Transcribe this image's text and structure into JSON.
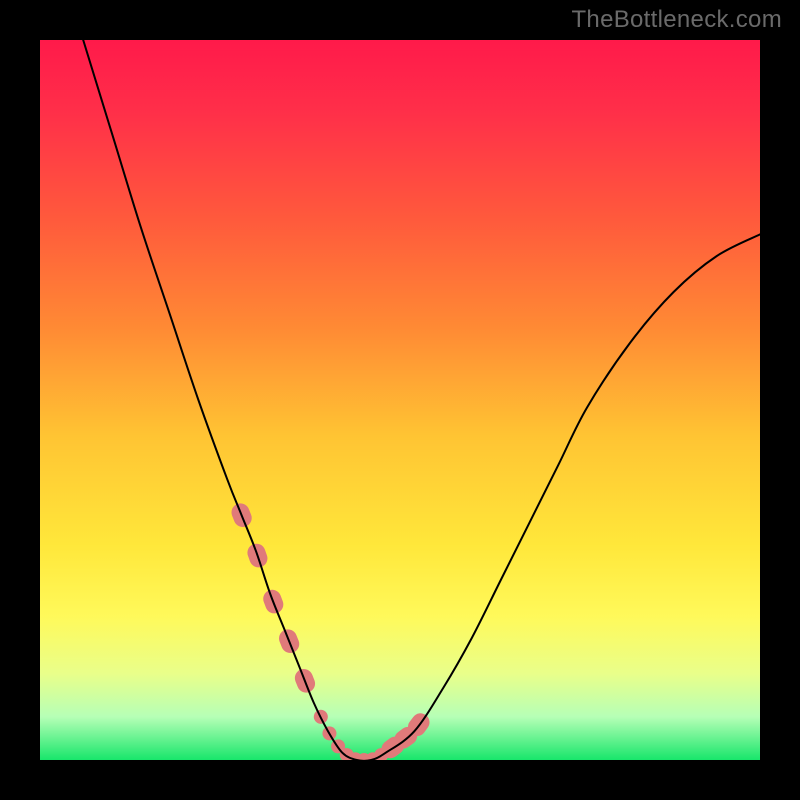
{
  "watermark": "TheBottleneck.com",
  "gradient_stops": [
    {
      "offset": 0.0,
      "color": "#ff1a4a"
    },
    {
      "offset": 0.1,
      "color": "#ff2f49"
    },
    {
      "offset": 0.25,
      "color": "#ff5a3c"
    },
    {
      "offset": 0.4,
      "color": "#ff8a34"
    },
    {
      "offset": 0.55,
      "color": "#ffc433"
    },
    {
      "offset": 0.7,
      "color": "#ffe73a"
    },
    {
      "offset": 0.8,
      "color": "#fff95a"
    },
    {
      "offset": 0.88,
      "color": "#e9ff8a"
    },
    {
      "offset": 0.94,
      "color": "#b6ffb6"
    },
    {
      "offset": 1.0,
      "color": "#18e66b"
    }
  ],
  "curve_color": "#000000",
  "boss_color": "#e07a7a",
  "chart_data": {
    "type": "line",
    "title": "",
    "xlabel": "",
    "ylabel": "",
    "xlim": [
      0,
      100
    ],
    "ylim": [
      0,
      100
    ],
    "series": [
      {
        "name": "bottleneck-curve",
        "x": [
          6,
          10,
          14,
          18,
          22,
          26,
          28,
          30,
          32,
          34,
          36,
          38,
          40,
          42,
          44,
          46,
          48,
          52,
          56,
          60,
          64,
          68,
          72,
          76,
          82,
          88,
          94,
          100
        ],
        "y": [
          100,
          87,
          74,
          62,
          50,
          39,
          34,
          29,
          23,
          18,
          13,
          8,
          4,
          1,
          0,
          0,
          1,
          4,
          10,
          17,
          25,
          33,
          41,
          49,
          58,
          65,
          70,
          73
        ]
      }
    ],
    "highlighted_region_x": [
      28,
      54
    ],
    "minimum_x": 44,
    "minimum_y": 0
  }
}
